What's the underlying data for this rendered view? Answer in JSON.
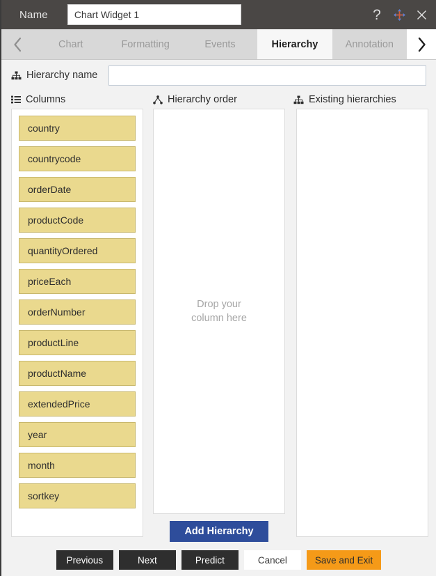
{
  "titlebar": {
    "name_label": "Name",
    "name_value": "Chart Widget 1",
    "name_placeholder": "",
    "help_icon": "question-mark-icon",
    "move_icon": "move-arrows-icon",
    "close_icon": "close-icon"
  },
  "tabstrip": {
    "prev_icon": "chevron-left-icon",
    "next_icon": "chevron-right-icon",
    "tabs": [
      {
        "label": "Chart",
        "active": false
      },
      {
        "label": "Formatting",
        "active": false
      },
      {
        "label": "Events",
        "active": false
      },
      {
        "label": "Hierarchy",
        "active": true
      },
      {
        "label": "Annotation",
        "active": false
      }
    ]
  },
  "hierarchy_name": {
    "icon": "sitemap-icon",
    "label": "Hierarchy name",
    "value": "",
    "placeholder": ""
  },
  "sections": {
    "columns": {
      "icon": "list-icon",
      "title": "Columns"
    },
    "hierarchy_order": {
      "icon": "hierarchy-order-icon",
      "title": "Hierarchy order"
    },
    "existing_hierarchies": {
      "icon": "sitemap-icon",
      "title": "Existing hierarchies"
    }
  },
  "columns": [
    "country",
    "countrycode",
    "orderDate",
    "productCode",
    "quantityOrdered",
    "priceEach",
    "orderNumber",
    "productLine",
    "productName",
    "extendedPrice",
    "year",
    "month",
    "sortkey"
  ],
  "hierarchy_order": {
    "drop_hint_line1": "Drop your",
    "drop_hint_line2": "column here",
    "items": [],
    "add_button_label": "Add Hierarchy"
  },
  "existing_hierarchies": {
    "items": []
  },
  "footer": {
    "buttons": [
      {
        "label": "Previous",
        "style": "dark"
      },
      {
        "label": "Next",
        "style": "dark"
      },
      {
        "label": "Predict",
        "style": "dark"
      },
      {
        "label": "Cancel",
        "style": "light"
      },
      {
        "label": "Save and Exit",
        "style": "orange"
      }
    ]
  },
  "colors": {
    "titlebar_bg": "#4a4745",
    "tabstrip_bg": "#d8d8d8",
    "active_tab_bg": "#f7f7f7",
    "chip_bg": "#ead98e",
    "chip_border": "#c8b86e",
    "add_button_bg": "#2e4d9b",
    "save_button_bg": "#f59a18",
    "dark_button_bg": "#2e2e2e"
  }
}
